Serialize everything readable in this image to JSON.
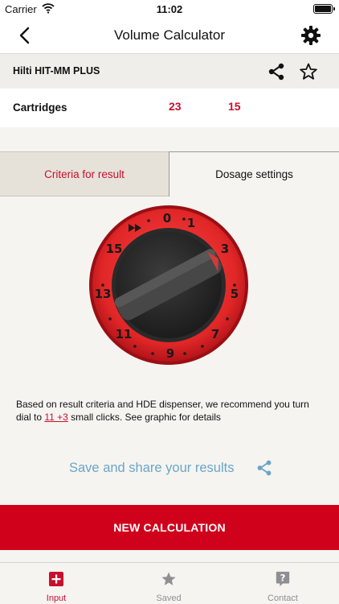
{
  "status_bar": {
    "carrier": "Carrier",
    "time": "11:02"
  },
  "nav": {
    "title": "Volume Calculator"
  },
  "product": {
    "name": "Hilti HIT-MM PLUS"
  },
  "cartridges": {
    "label": "Cartridges",
    "value_1": "23",
    "value_2": "15"
  },
  "tabs": [
    {
      "label": "Criteria for result",
      "active": false
    },
    {
      "label": "Dosage settings",
      "active": true
    }
  ],
  "dial": {
    "numbers": [
      "0",
      "1",
      "3",
      "5",
      "7",
      "9",
      "11",
      "13",
      "15"
    ],
    "fast_forward_symbol": "▶▶",
    "colors": {
      "ring": "#e02626",
      "ring_dark": "#9a0f14",
      "knob": "#2f2f2f",
      "marker": "#d23a3a"
    }
  },
  "recommendation": {
    "text_before": "Based on result criteria and HDE dispenser, we recommend you turn dial to ",
    "link_text": "11 +3",
    "text_after": " small clicks. See graphic for details"
  },
  "save_share": {
    "label": "Save and share your results"
  },
  "new_calculation": {
    "label": "NEW CALCULATION"
  },
  "tab_bar": {
    "items": [
      {
        "label": "Input",
        "icon": "plus-square-icon",
        "active": true
      },
      {
        "label": "Saved",
        "icon": "star-icon",
        "active": false
      },
      {
        "label": "Contact",
        "icon": "question-bubble-icon",
        "active": false
      }
    ]
  },
  "colors": {
    "brand_red": "#c8102e",
    "link_blue": "#6aa6c6",
    "button_red": "#d0021b"
  }
}
